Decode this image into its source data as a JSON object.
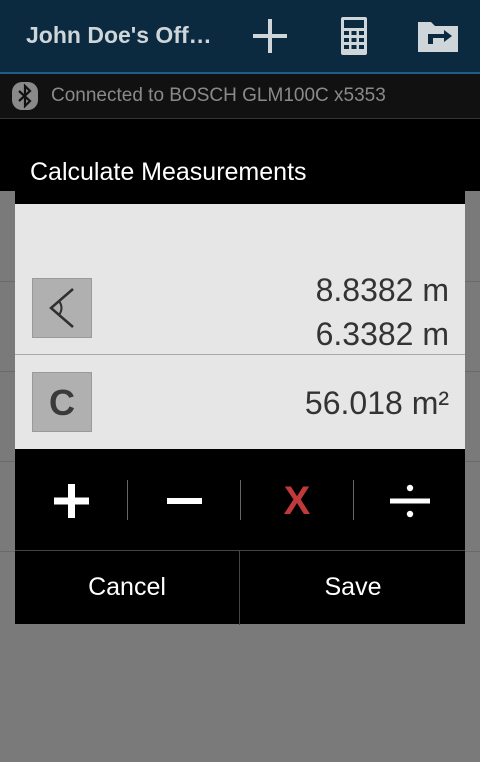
{
  "appbar": {
    "title": "John Doe's Offi…",
    "icons": [
      "add-icon",
      "calculator-icon",
      "folder-icon"
    ]
  },
  "status": {
    "icon": "bluetooth-icon",
    "text": "Connected to BOSCH GLM100C x5353"
  },
  "dialog": {
    "title": "Calculate Measurements",
    "measurements": [
      "8.8382 m",
      "6.3382 m"
    ],
    "result": "56.018 m²",
    "clear_label": "C",
    "operators": [
      "plus",
      "minus",
      "multiply",
      "divide"
    ],
    "multiply_label": "X",
    "cancel_label": "Cancel",
    "save_label": "Save"
  },
  "colors": {
    "appbar_bg": "#0b2a40",
    "multiply_red": "#c0393b",
    "panel_bg": "#e6e6e6"
  }
}
